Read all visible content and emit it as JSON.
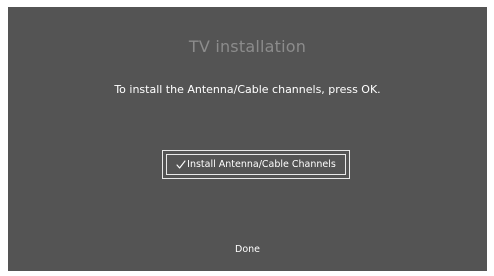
{
  "title": "TV installation",
  "instruction": "To install the Antenna/Cable channels, press OK.",
  "option": {
    "label": "Install Antenna/Cable Channels",
    "checked": true,
    "check_icon": "checkmark-icon"
  },
  "done_label": "Done",
  "colors": {
    "screen_background": "#545454",
    "title_text": "#8c8c8c",
    "text": "#ffffff",
    "focus_border": "#e9e9e9"
  }
}
